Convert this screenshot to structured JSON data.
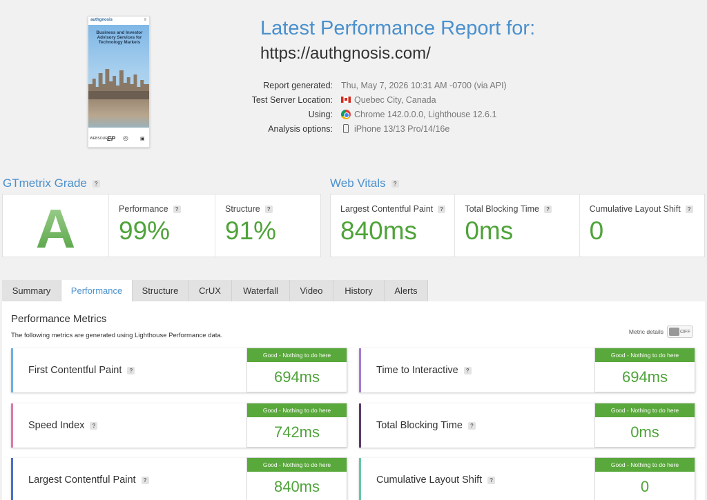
{
  "thumbnail": {
    "brand": "authgnosis",
    "headline": "Business and Investor Advisory Services for Technology Markets",
    "logos": [
      "WEBSOURCE",
      "EP",
      "◎",
      "▣"
    ]
  },
  "report": {
    "title": "Latest Performance Report for:",
    "url": "https://authgnosis.com/",
    "meta": [
      {
        "label": "Report generated:",
        "value": "Thu, May 7, 2026 10:31 AM -0700 (via API)",
        "icon": ""
      },
      {
        "label": "Test Server Location:",
        "value": "Quebec City, Canada",
        "icon": "canada-flag-icon"
      },
      {
        "label": "Using:",
        "value": "Chrome 142.0.0.0, Lighthouse 12.6.1",
        "icon": "chrome-icon"
      },
      {
        "label": "Analysis options:",
        "value": "iPhone 13/13 Pro/14/16e",
        "icon": "phone-icon"
      }
    ]
  },
  "grade": {
    "title": "GTmetrix Grade",
    "letter": "A",
    "performance_label": "Performance",
    "performance_value": "99%",
    "structure_label": "Structure",
    "structure_value": "91%"
  },
  "vitals": {
    "title": "Web Vitals",
    "items": [
      {
        "label": "Largest Contentful Paint",
        "value": "840ms"
      },
      {
        "label": "Total Blocking Time",
        "value": "0ms"
      },
      {
        "label": "Cumulative Layout Shift",
        "value": "0"
      }
    ]
  },
  "tabs": [
    "Summary",
    "Performance",
    "Structure",
    "CrUX",
    "Waterfall",
    "Video",
    "History",
    "Alerts"
  ],
  "active_tab": "Performance",
  "performance": {
    "title": "Performance Metrics",
    "subtitle": "The following metrics are generated using Lighthouse Performance data.",
    "metric_details_label": "Metric details",
    "toggle_state": "OFF",
    "metrics": [
      {
        "name": "First Contentful Paint",
        "badge": "Good - Nothing to do here",
        "value": "694ms",
        "color": "#6db0e6"
      },
      {
        "name": "Time to Interactive",
        "badge": "Good - Nothing to do here",
        "value": "694ms",
        "color": "#a77ad0"
      },
      {
        "name": "Speed Index",
        "badge": "Good - Nothing to do here",
        "value": "742ms",
        "color": "#e277a7"
      },
      {
        "name": "Total Blocking Time",
        "badge": "Good - Nothing to do here",
        "value": "0ms",
        "color": "#5a3a6e"
      },
      {
        "name": "Largest Contentful Paint",
        "badge": "Good - Nothing to do here",
        "value": "840ms",
        "color": "#4a6fc9"
      },
      {
        "name": "Cumulative Layout Shift",
        "badge": "Good - Nothing to do here",
        "value": "0",
        "color": "#63c7a6"
      }
    ]
  },
  "colors": {
    "accent": "#4a90cd",
    "good": "#59a83b"
  }
}
